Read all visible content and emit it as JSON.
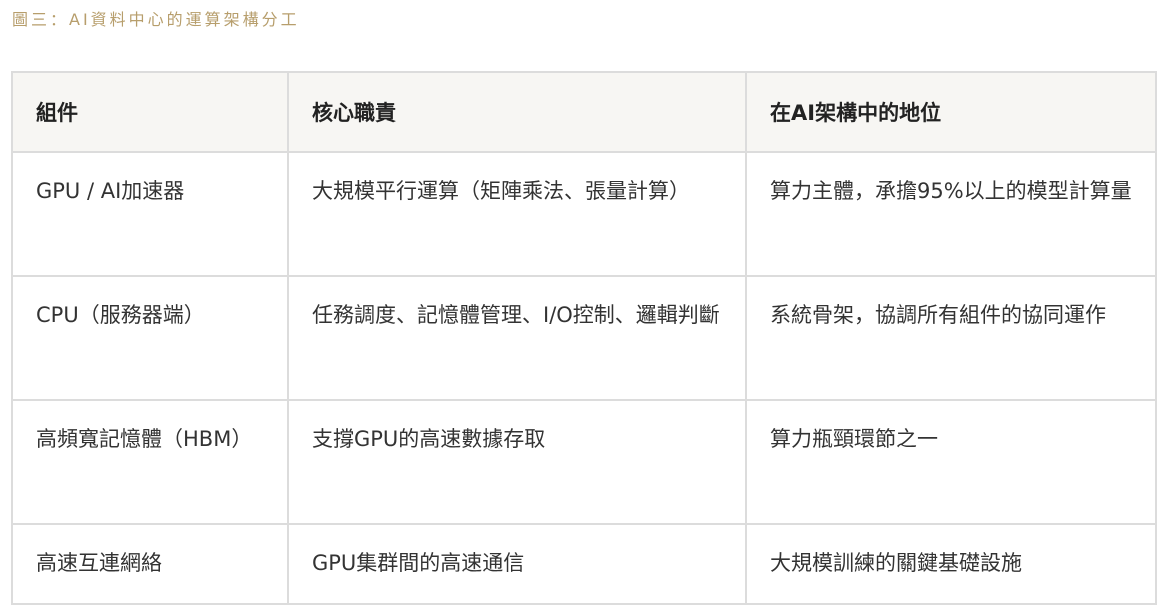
{
  "caption": "圖三：AI資料中心的運算架構分工",
  "table": {
    "headers": [
      "組件",
      "核心職責",
      "在AI架構中的地位"
    ],
    "rows": [
      [
        "GPU / AI加速器",
        "大規模平行運算（矩陣乘法、張量計算）",
        "算力主體，承擔95%以上的模型計算量"
      ],
      [
        "CPU（服務器端）",
        "任務調度、記憶體管理、I/O控制、邏輯判斷",
        "系統骨架，協調所有組件的協同運作"
      ],
      [
        "高頻寬記憶體（HBM）",
        "支撐GPU的高速數據存取",
        "算力瓶頸環節之一"
      ],
      [
        "高速互連網絡",
        "GPU集群間的高速通信",
        "大規模訓練的關鍵基礎設施"
      ]
    ]
  }
}
